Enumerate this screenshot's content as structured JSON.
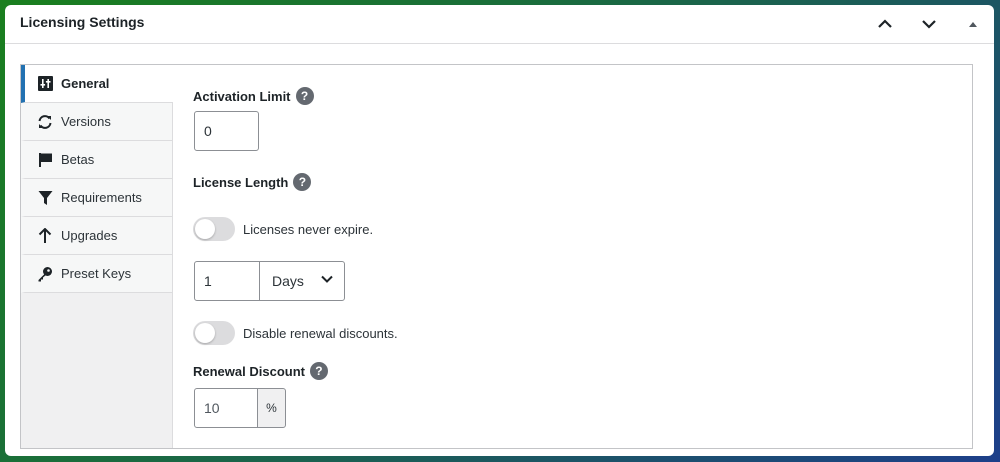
{
  "header": {
    "title": "Licensing Settings",
    "up_icon": "chevron-up-icon",
    "down_icon": "chevron-down-icon",
    "toggle_icon": "triangle-up-icon"
  },
  "sidebar": {
    "items": [
      {
        "label": "General",
        "icon": "sliders-icon",
        "active": true
      },
      {
        "label": "Versions",
        "icon": "refresh-icon",
        "active": false
      },
      {
        "label": "Betas",
        "icon": "flag-icon",
        "active": false
      },
      {
        "label": "Requirements",
        "icon": "filter-icon",
        "active": false
      },
      {
        "label": "Upgrades",
        "icon": "arrow-up-icon",
        "active": false
      },
      {
        "label": "Preset Keys",
        "icon": "key-icon",
        "active": false
      }
    ]
  },
  "general": {
    "activation_limit_label": "Activation Limit",
    "activation_limit_value": "0",
    "license_length_label": "License Length",
    "never_expire_label": "Licenses never expire.",
    "never_expire_on": false,
    "length_value": "1",
    "length_unit": "Days",
    "disable_renewal_label": "Disable renewal discounts.",
    "disable_renewal_on": false,
    "renewal_discount_label": "Renewal Discount",
    "renewal_discount_value": "10",
    "renewal_discount_suffix": "%",
    "help_glyph": "?"
  },
  "colors": {
    "accent": "#2271b1",
    "toggle_off": "#dcdcde",
    "help_icon": "#646970"
  }
}
